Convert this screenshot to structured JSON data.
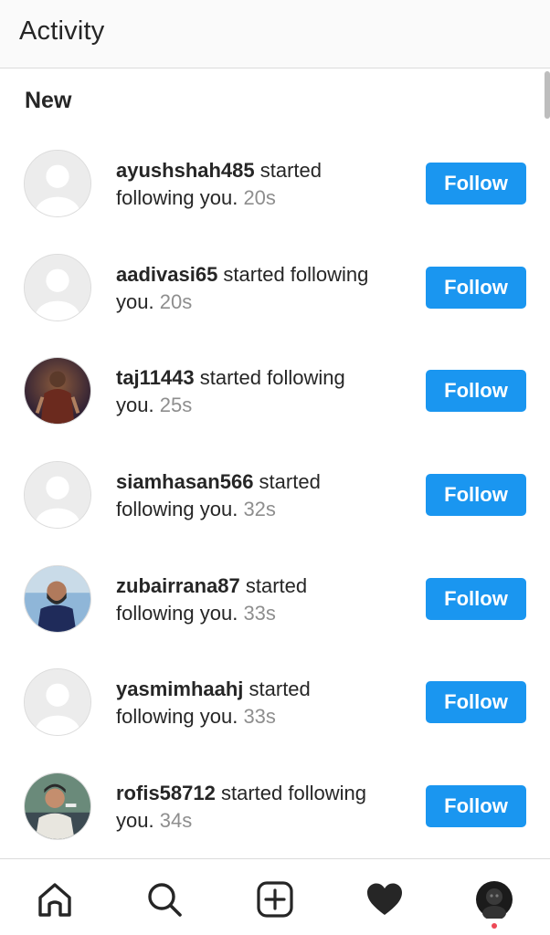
{
  "header": {
    "title": "Activity"
  },
  "section": {
    "title": "New"
  },
  "activity": [
    {
      "username": "ayushshah485",
      "line_a": " started",
      "line_b": "following you.",
      "time": "20s",
      "button": "Follow",
      "avatar": "default"
    },
    {
      "username": "aadivasi65",
      "line_a": " started following",
      "line_b": "you.",
      "time": "20s",
      "button": "Follow",
      "avatar": "default"
    },
    {
      "username": "taj11443",
      "line_a": " started following",
      "line_b": "you.",
      "time": "25s",
      "button": "Follow",
      "avatar": "photo"
    },
    {
      "username": "siamhasan566",
      "line_a": " started",
      "line_b": "following you.",
      "time": "32s",
      "button": "Follow",
      "avatar": "default"
    },
    {
      "username": "zubairrana87",
      "line_a": " started",
      "line_b": "following you.",
      "time": "33s",
      "button": "Follow",
      "avatar": "photo"
    },
    {
      "username": "yasmimhaahj",
      "line_a": " started",
      "line_b": "following you.",
      "time": "33s",
      "button": "Follow",
      "avatar": "default"
    },
    {
      "username": "rofis58712",
      "line_a": " started following",
      "line_b": "you.",
      "time": "34s",
      "button": "Follow",
      "avatar": "photo"
    }
  ],
  "nav": {
    "items": [
      "home-icon",
      "search-icon",
      "new-post-icon",
      "activity-heart-icon",
      "profile-avatar"
    ],
    "active": "activity-heart-icon",
    "notification_dot_color": "#ed4956"
  },
  "colors": {
    "accent": "#1a96f0",
    "timestamp": "#8e8e8e",
    "text": "#262626"
  }
}
